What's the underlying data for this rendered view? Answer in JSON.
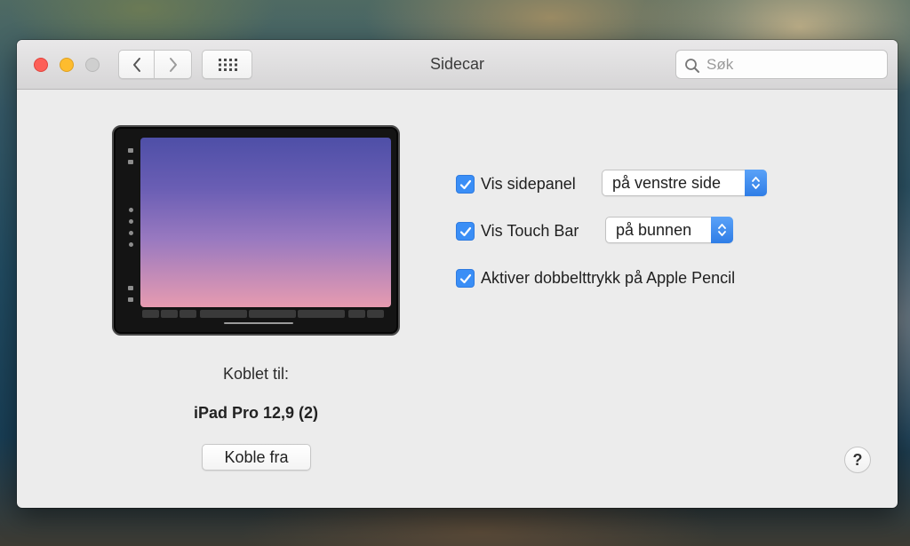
{
  "window": {
    "title": "Sidecar"
  },
  "toolbar": {
    "back_icon": "chevron-left-icon",
    "forward_icon": "chevron-right-icon",
    "grid_icon": "grid-icon"
  },
  "search": {
    "placeholder": "Søk",
    "icon": "search-icon"
  },
  "device": {
    "connected_label": "Koblet til:",
    "name": "iPad Pro 12,9 (2)",
    "disconnect_label": "Koble fra"
  },
  "options": [
    {
      "label": "Vis sidepanel",
      "checked": true,
      "popup_value": "på venstre side"
    },
    {
      "label": "Vis Touch Bar",
      "checked": true,
      "popup_value": "på bunnen"
    },
    {
      "label": "Aktiver dobbelttrykk på Apple Pencil",
      "checked": true
    }
  ],
  "help": {
    "label": "?"
  },
  "colors": {
    "accent": "#3a8ef6",
    "close": "#fd5f57",
    "minimize": "#febc2e",
    "zoom_disabled": "#cfcfcf"
  }
}
